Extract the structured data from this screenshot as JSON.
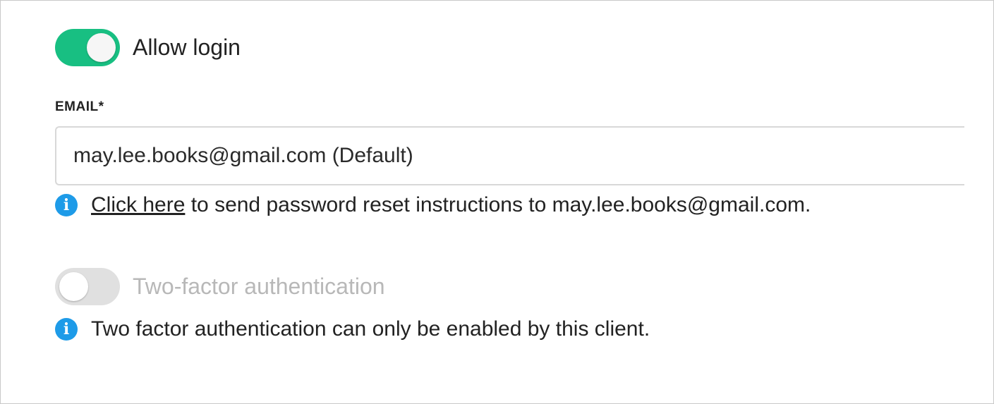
{
  "allow_login": {
    "label": "Allow login",
    "checked": true,
    "accent_color": "#18bf82"
  },
  "email": {
    "label": "EMAIL*",
    "value": "may.lee.books@gmail.com (Default)"
  },
  "reset_help": {
    "icon": "info-icon",
    "link_text": "Click here",
    "text": " to send password reset instructions to may.lee.books@gmail.com."
  },
  "two_factor": {
    "label": "Two-factor authentication",
    "checked": false,
    "disabled": true
  },
  "two_factor_help": {
    "icon": "info-icon",
    "text": "Two factor authentication can only be enabled by this client."
  },
  "colors": {
    "info_icon": "#1e9be8",
    "toggle_on": "#18bf82",
    "toggle_off": "#e0e0e0"
  }
}
